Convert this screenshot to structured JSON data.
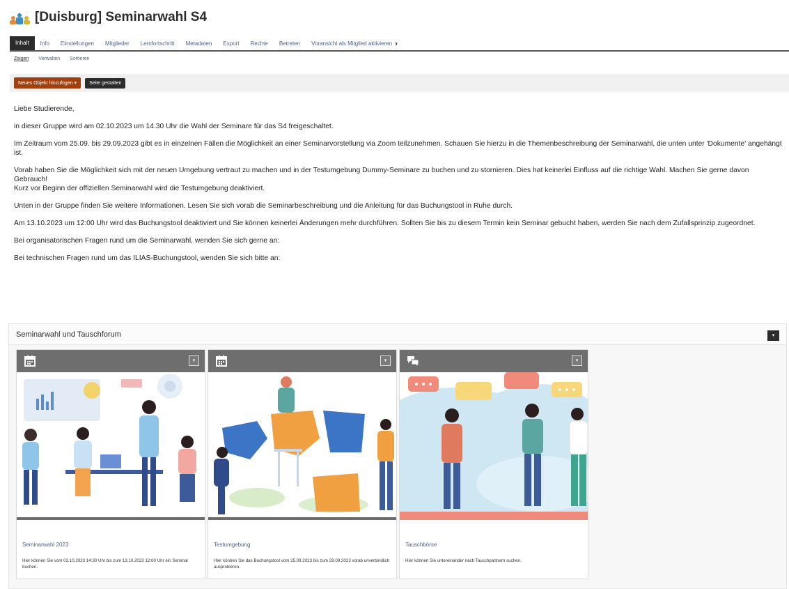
{
  "header": {
    "title": "[Duisburg] Seminarwahl S4"
  },
  "tabs": [
    "Inhalt",
    "Info",
    "Einstellungen",
    "Mitglieder",
    "Lernfortschritt",
    "Metadaten",
    "Export",
    "Rechte",
    "Betreten",
    "Voransicht als Mitglied aktivieren"
  ],
  "subtabs": [
    "Zeigen",
    "Verwalten",
    "Sortieren"
  ],
  "toolbar": {
    "add_label": "Neues Objekt hinzufügen ▾",
    "design_label": "Seite gestalten"
  },
  "content": {
    "p1": "Liebe Studierende,",
    "p2": "in dieser Gruppe wird am 02.10.2023 um 14.30 Uhr die Wahl der Seminare für das S4 freigeschaltet.",
    "p3": "Im Zeitraum vom 25.09. bis 29.09.2023 gibt es in einzelnen Fällen die Möglichkeit an einer Seminarvorstellung via Zoom teilzunehmen. Schauen Sie hierzu in die Themenbeschreibung der Seminarwahl, die unten unter 'Dokumente' angehängt ist.",
    "p4a": "Vorab haben Sie die Möglichkeit sich mit der neuen Umgebung vertraut zu machen und in der Testumgebung Dummy-Seminare zu buchen und zu stornieren. Dies hat keinerlei Einfluss auf die richtige Wahl. Machen Sie gerne davon Gebrauch!",
    "p4b": "Kurz vor Beginn der offiziellen Seminarwahl wird die Testumgebung deaktiviert.",
    "p5": "Unten in der Gruppe finden Sie weitere Informationen. Lesen Sie sich vorab die Seminarbeschreibung und die Anleitung für das Buchungstool in Ruhe durch.",
    "p6": "Am 13.10.2023 um 12:00 Uhr wird das Buchungstool deaktiviert und Sie können keinerlei Änderungen mehr durchführen. Sollten Sie bis zu diesem Termin kein Seminar gebucht haben, werden Sie nach dem Zufallsprinzip zugeordnet.",
    "p7": "Bei organisatorischen Fragen rund um die Seminarwahl, wenden Sie sich gerne an:",
    "p8": "Bei technischen Fragen rund um das ILIAS-Buchungstool, wenden Sie sich bitte an:"
  },
  "block": {
    "title": "Seminarwahl und Tauschforum",
    "cards": [
      {
        "title": "Seminarwahl 2023",
        "desc": "Hier können Sie vom 02.10.2023 14:30 Uhr bis zum 13.10.2023 12:00 Uhr ein Seminar buchen.",
        "icon": "calendar-icon"
      },
      {
        "title": "Testumgebung",
        "desc": "Hier können Sie das Buchungstool vom 25.09.2023 bis zum 29.09.2023 vorab unverbindlich ausprobieren.",
        "icon": "calendar-icon"
      },
      {
        "title": "Tauschbörse",
        "desc": "Hier können Sie untereinander nach Tauschpartnern suchen.",
        "icon": "forum-icon"
      }
    ]
  },
  "colors": {
    "accent": "#a0400e",
    "link": "#4c6586",
    "dark": "#2c2c2c"
  }
}
